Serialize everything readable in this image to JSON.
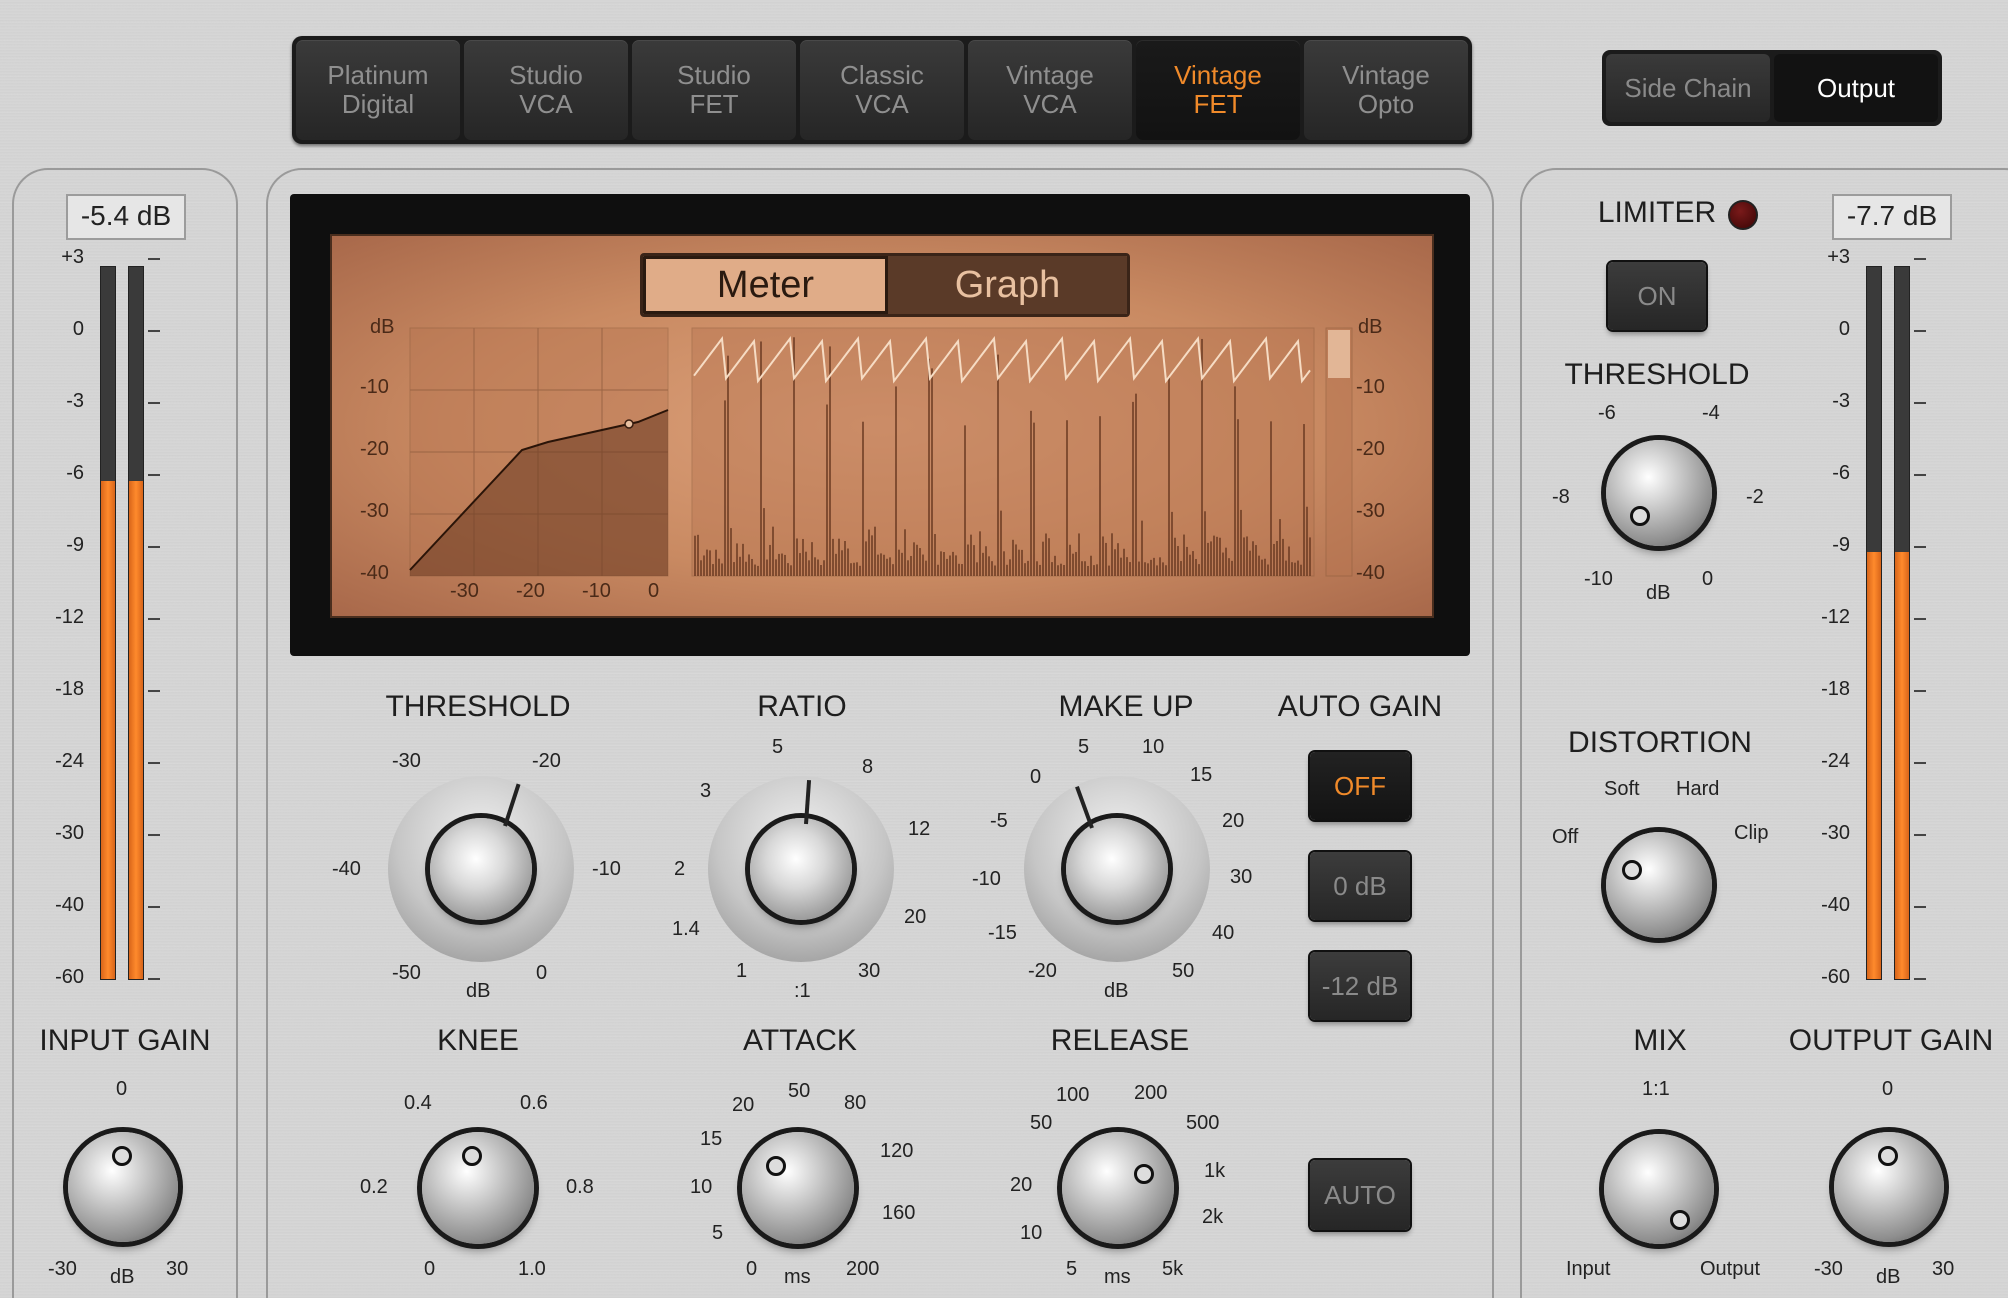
{
  "models": [
    {
      "label": "Platinum\nDigital"
    },
    {
      "label": "Studio\nVCA"
    },
    {
      "label": "Studio\nFET"
    },
    {
      "label": "Classic\nVCA"
    },
    {
      "label": "Vintage\nVCA"
    },
    {
      "label": "Vintage\nFET"
    },
    {
      "label": "Vintage\nOpto"
    }
  ],
  "active_model": "Vintage FET",
  "routing": {
    "side_chain": "Side Chain",
    "output": "Output",
    "active": "Output"
  },
  "input": {
    "readout": "-5.4 dB",
    "scale": [
      "+3",
      "0",
      "-3",
      "-6",
      "-9",
      "-12",
      "-18",
      "-24",
      "-30",
      "-40",
      "-60"
    ],
    "level_db": -6,
    "gain_label": "INPUT GAIN",
    "gain_min": "-30",
    "gain_mid": "0",
    "gain_max": "30",
    "gain_unit": "dB"
  },
  "output": {
    "readout": "-7.7 dB",
    "scale": [
      "+3",
      "0",
      "-3",
      "-6",
      "-9",
      "-12",
      "-18",
      "-24",
      "-30",
      "-40",
      "-60"
    ],
    "level_db": -9,
    "gain_label": "OUTPUT GAIN",
    "gain_min": "-30",
    "gain_mid": "0",
    "gain_max": "30",
    "gain_unit": "dB"
  },
  "display": {
    "meter_label": "Meter",
    "graph_label": "Graph",
    "active_view": "Graph",
    "db_label": "dB",
    "y_ticks": [
      "-10",
      "-20",
      "-30",
      "-40"
    ],
    "x_ticks": [
      "-30",
      "-20",
      "-10",
      "0"
    ],
    "right_db_label": "dB",
    "right_ticks": [
      "-10",
      "-20",
      "-30",
      "-40"
    ]
  },
  "knobs": {
    "threshold": {
      "label": "THRESHOLD",
      "scale": [
        "-30",
        "-20",
        "-10",
        "0",
        "-50",
        "-40"
      ],
      "unit": "dB"
    },
    "ratio": {
      "label": "RATIO",
      "scale": [
        "5",
        "8",
        "12",
        "20",
        "30",
        "1",
        "1.4",
        "2",
        "3"
      ],
      "unit": ":1"
    },
    "makeup": {
      "label": "MAKE UP",
      "scale": [
        "5",
        "10",
        "15",
        "20",
        "30",
        "40",
        "50",
        "-20",
        "-15",
        "-10",
        "-5",
        "0"
      ],
      "unit": "dB"
    },
    "knee": {
      "label": "KNEE",
      "scale": [
        "0.4",
        "0.6",
        "0.8",
        "1.0",
        "0",
        "0.2"
      ]
    },
    "attack": {
      "label": "ATTACK",
      "scale": [
        "50",
        "80",
        "120",
        "160",
        "200",
        "0",
        "5",
        "10",
        "15",
        "20"
      ],
      "unit": "ms"
    },
    "release": {
      "label": "RELEASE",
      "scale": [
        "100",
        "200",
        "500",
        "1k",
        "2k",
        "5k",
        "5",
        "10",
        "20",
        "50"
      ],
      "unit": "ms"
    }
  },
  "auto_gain": {
    "label": "AUTO GAIN",
    "buttons": [
      "OFF",
      "0 dB",
      "-12 dB"
    ],
    "active": "OFF",
    "auto_button": "AUTO"
  },
  "limiter": {
    "label": "LIMITER",
    "on_button": "ON",
    "threshold_label": "THRESHOLD",
    "scale": [
      "-6",
      "-4",
      "-2",
      "0",
      "-10",
      "-8"
    ],
    "unit": "dB"
  },
  "distortion": {
    "label": "DISTORTION",
    "options": [
      "Off",
      "Soft",
      "Hard",
      "Clip"
    ]
  },
  "mix": {
    "label": "MIX",
    "top": "1:1",
    "left": "Input",
    "right": "Output"
  }
}
